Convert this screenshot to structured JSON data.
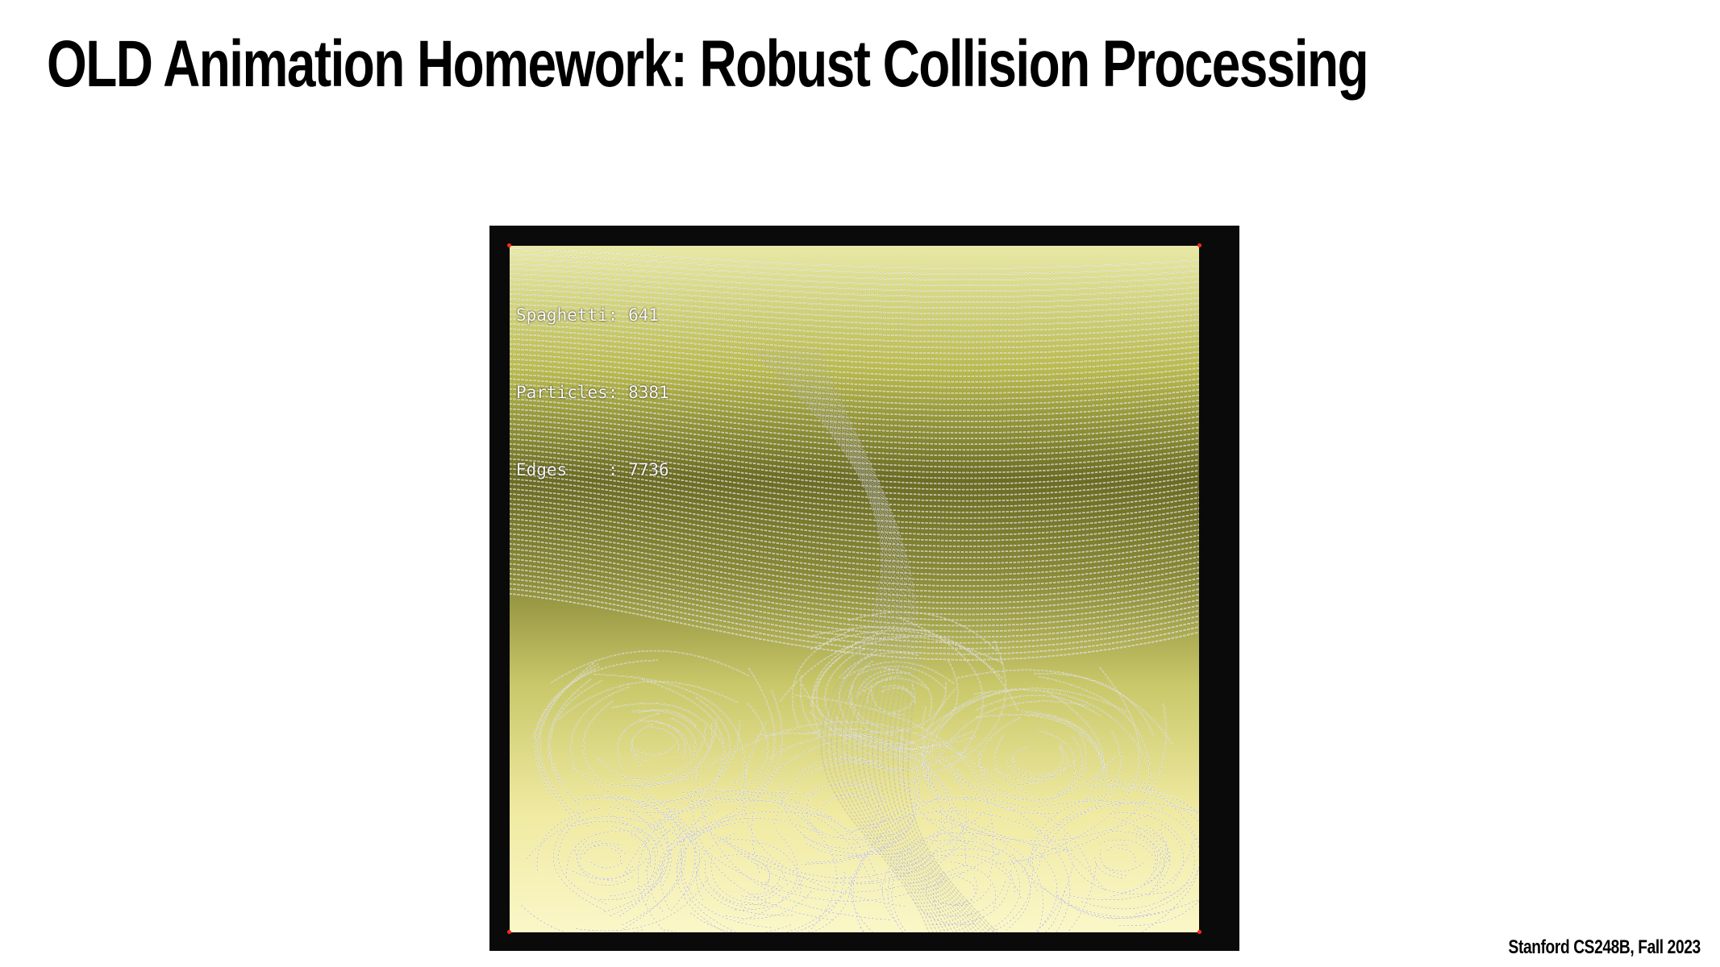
{
  "slide": {
    "title": "OLD Animation Homework:  Robust Collision Processing",
    "footer": "Stanford CS248B, Fall 2023"
  },
  "simulation": {
    "stats": [
      "Spaghetti: 641",
      "Particles: 8381",
      "Edges    : 7736"
    ],
    "colors": {
      "frame": "#0a0a0a",
      "strand_light": "#fbf5b8",
      "strand_dark": "#1a1a0a",
      "particle": "#ffffff",
      "corner_marker": "#ff2a1a"
    }
  }
}
